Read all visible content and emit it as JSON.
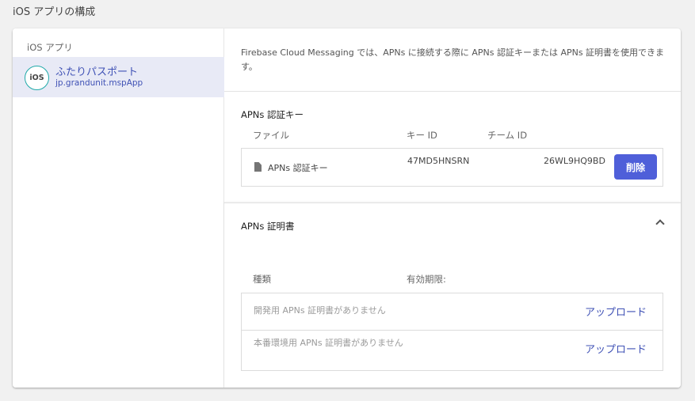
{
  "page": {
    "section_title": "iOS アプリの構成"
  },
  "sidebar": {
    "heading": "iOS アプリ",
    "app": {
      "avatar": "iOS",
      "name": "ふたりパスポート",
      "bundle_id": "jp.grandunit.mspApp"
    }
  },
  "main": {
    "intro": "Firebase Cloud Messaging では、APNs に接続する際に APNs 認証キーまたは APNs 証明書を使用できます。",
    "key_section": {
      "title": "APNs 認証キー",
      "columns": {
        "file": "ファイル",
        "key_id": "キー ID",
        "team_id": "チーム ID"
      },
      "row": {
        "icon": "file-icon",
        "file": "APNs 認証キー",
        "key_id": "47MD5HNSRN",
        "team_id": "26WL9HQ9BD",
        "delete_label": "削除"
      }
    },
    "cert_section": {
      "title": "APNs 証明書",
      "columns": {
        "type": "種類",
        "expiry": "有効期限:"
      },
      "rows": [
        {
          "text": "開発用 APNs 証明書がありません",
          "action": "アップロード"
        },
        {
          "text": "本番環境用 APNs 証明書がありません",
          "action": "アップロード"
        }
      ]
    }
  },
  "colors": {
    "accent": "#3f51b5",
    "button": "#4f5fd9",
    "selected_bg": "#e8eaf6",
    "ios_ring": "#1fa9a9"
  }
}
